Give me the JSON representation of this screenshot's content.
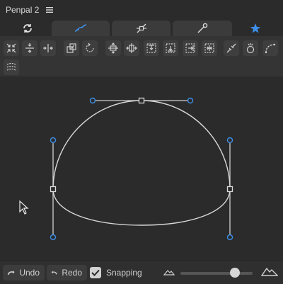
{
  "app": {
    "title": "Penpal 2",
    "menu_icon": "hamburger-menu-icon"
  },
  "tabs": [
    {
      "name": "refresh-icon",
      "active": false
    },
    {
      "name": "curve-icon",
      "active": true
    },
    {
      "name": "node-tool-icon",
      "active": false
    },
    {
      "name": "pen-tool-icon",
      "active": false
    },
    {
      "name": "star-icon",
      "active": false,
      "color": "#3d8ee6"
    }
  ],
  "toolbar": {
    "icons": [
      "collapse-icon",
      "align-center-vertical-icon",
      "align-center-horizontal-icon",
      "scale-icon",
      "rotate-icon",
      "move-vertical-icon",
      "move-horizontal-icon",
      "distribute-top-icon",
      "distribute-middle-icon",
      "distribute-right-icon",
      "distribute-center-icon",
      "break-path-icon",
      "close-path-icon",
      "smooth-curve-icon",
      "simplify-path-icon"
    ]
  },
  "bottom": {
    "undo_label": "Undo",
    "redo_label": "Redo",
    "snapping_label": "Snapping",
    "snapping_checked": true,
    "zoom_level": 0.72
  },
  "colors": {
    "accent": "#3d8ee6",
    "curve": "#d8d8d8",
    "handle": "#3d8ee6"
  }
}
